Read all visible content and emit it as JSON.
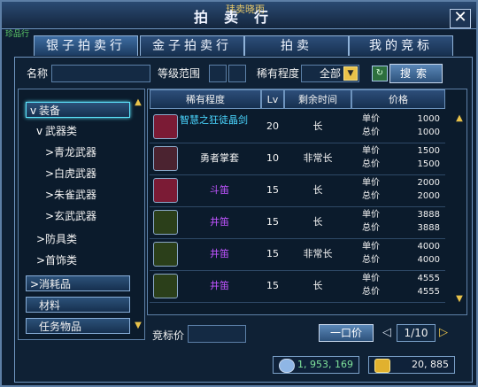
{
  "window": {
    "title": "拍卖行",
    "npc_label": "玮卖晓雨",
    "left_tag": "珍品行",
    "close_label": "✕"
  },
  "tabs": [
    {
      "label": "银子拍卖行"
    },
    {
      "label": "金子拍卖行"
    },
    {
      "label": "拍卖"
    },
    {
      "label": "我的竞标"
    }
  ],
  "filters": {
    "name_label": "名称",
    "level_label": "等级范围",
    "rarity_label": "稀有程度",
    "rarity_value": "全部",
    "search_label": "搜索"
  },
  "tree": {
    "items": [
      {
        "label": "装备",
        "arrow": "v",
        "level": 0,
        "selected": true
      },
      {
        "label": "武器类",
        "arrow": "v",
        "level": 1
      },
      {
        "label": "青龙武器",
        "arrow": ">",
        "level": 2
      },
      {
        "label": "白虎武器",
        "arrow": ">",
        "level": 2
      },
      {
        "label": "朱雀武器",
        "arrow": ">",
        "level": 2
      },
      {
        "label": "玄武武器",
        "arrow": ">",
        "level": 2
      },
      {
        "label": "防具类",
        "arrow": ">",
        "level": 1
      },
      {
        "label": "首饰类",
        "arrow": ">",
        "level": 1
      },
      {
        "label": "消耗品",
        "arrow": ">",
        "level": 0
      },
      {
        "label": "材料",
        "arrow": "",
        "level": 0
      },
      {
        "label": "任务物品",
        "arrow": "",
        "level": 0
      }
    ]
  },
  "grid": {
    "headers": [
      "稀有程度",
      "Lv",
      "剩余时间",
      "价格"
    ],
    "unit_label": "单价",
    "total_label": "总价",
    "rows": [
      {
        "name": "智慧之狂徒晶剑",
        "name_color": "#4ad6ff",
        "lv": "20",
        "time": "长",
        "unit": "1000",
        "total": "1000",
        "icon": "sword-icon"
      },
      {
        "name": "勇者掌套",
        "name_color": "#f2f2f2",
        "lv": "10",
        "time": "非常长",
        "unit": "1500",
        "total": "1500",
        "icon": "gauntlet-icon"
      },
      {
        "name": "斗笛",
        "name_color": "#c054ff",
        "lv": "15",
        "time": "长",
        "unit": "2000",
        "total": "2000",
        "icon": "flute-icon"
      },
      {
        "name": "井笛",
        "name_color": "#c054ff",
        "lv": "15",
        "time": "长",
        "unit": "3888",
        "total": "3888",
        "icon": "staff-icon"
      },
      {
        "name": "井笛",
        "name_color": "#c054ff",
        "lv": "15",
        "time": "非常长",
        "unit": "4000",
        "total": "4000",
        "icon": "staff-icon"
      },
      {
        "name": "井笛",
        "name_color": "#c054ff",
        "lv": "15",
        "time": "长",
        "unit": "4555",
        "total": "4555",
        "icon": "staff-icon"
      }
    ]
  },
  "bottom": {
    "bid_label": "竞标价",
    "buyout_label": "一口价",
    "page": "1/10",
    "silver": "1, 953, 169",
    "gold": "20, 885"
  },
  "colors": {
    "accent": "#5ee7ff",
    "gold": "#e9c24a",
    "rare_purple": "#c054ff",
    "rare_cyan": "#4ad6ff"
  }
}
